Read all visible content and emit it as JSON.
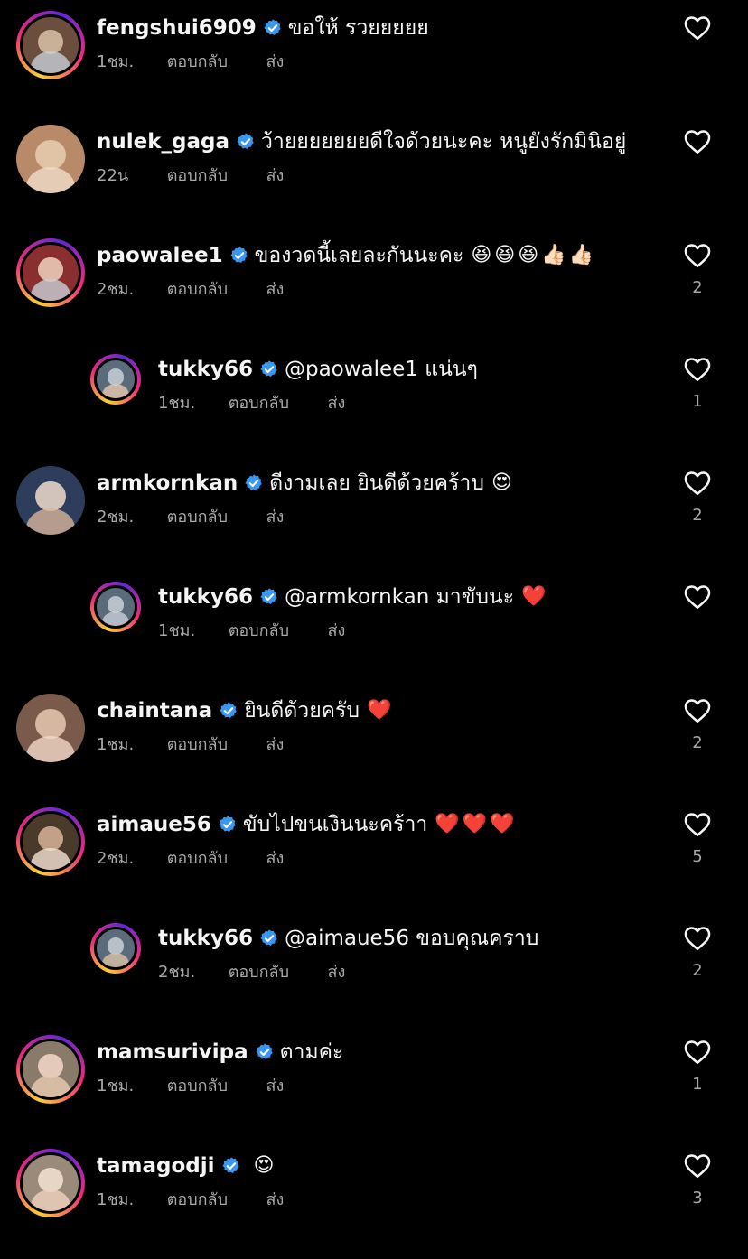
{
  "ui": {
    "reply_label": "ตอบกลับ",
    "send_label": "ส่ง"
  },
  "colors": {
    "background": "#000000",
    "verified": "#3897f0",
    "muted_text": "#a8a8a8",
    "story_ring": [
      "#f9ce34",
      "#ee2a7b",
      "#6228d7"
    ]
  },
  "comments": [
    {
      "username": "fengshui6909",
      "verified": true,
      "text": "ขอให้ รวยยยยย",
      "emojis": "",
      "time": "1ชม.",
      "likes": "",
      "is_reply": false,
      "story_ring": true
    },
    {
      "username": "nulek_gaga",
      "verified": true,
      "text": "ว้ายยยยยยยดีใจด้วยนะคะ  หนูยังรักมินิอยู่",
      "emojis": "",
      "time": "22น",
      "likes": "",
      "is_reply": false,
      "story_ring": false
    },
    {
      "username": "paowalee1",
      "verified": true,
      "text": "ของวดนี้เลยละกันนะคะ",
      "emojis": "😆😆😆👍🏻👍🏻",
      "time": "2ชม.",
      "likes": "2",
      "is_reply": false,
      "story_ring": true
    },
    {
      "username": "tukky66",
      "verified": true,
      "text": "@paowalee1 แน่นๆ",
      "emojis": "",
      "time": "1ชม.",
      "likes": "1",
      "is_reply": true,
      "story_ring": true
    },
    {
      "username": "armkornkan",
      "verified": true,
      "text": "ดีงามเลย ยินดีด้วยคร้าบ",
      "emojis": "😍",
      "time": "2ชม.",
      "likes": "2",
      "is_reply": false,
      "story_ring": false
    },
    {
      "username": "tukky66",
      "verified": true,
      "text": "@armkornkan มาขับนะ",
      "emojis": "❤️",
      "time": "1ชม.",
      "likes": "",
      "is_reply": true,
      "story_ring": true
    },
    {
      "username": "chaintana",
      "verified": true,
      "text": "ยินดีด้วยครับ",
      "emojis": "❤️",
      "time": "1ชม.",
      "likes": "2",
      "is_reply": false,
      "story_ring": false
    },
    {
      "username": "aimaue56",
      "verified": true,
      "text": "ขับไปขนเงินนะคร้าา",
      "emojis": "❤️❤️❤️",
      "time": "2ชม.",
      "likes": "5",
      "is_reply": false,
      "story_ring": true
    },
    {
      "username": "tukky66",
      "verified": true,
      "text": "@aimaue56 ขอบคุณคราบ",
      "emojis": "",
      "time": "2ชม.",
      "likes": "2",
      "is_reply": true,
      "story_ring": true
    },
    {
      "username": "mamsurivipa",
      "verified": true,
      "text": "ตามค่ะ",
      "emojis": "",
      "time": "1ชม.",
      "likes": "1",
      "is_reply": false,
      "story_ring": true
    },
    {
      "username": "tamagodji",
      "verified": true,
      "text": "",
      "emojis": "😍",
      "time": "1ชม.",
      "likes": "3",
      "is_reply": false,
      "story_ring": true
    }
  ]
}
